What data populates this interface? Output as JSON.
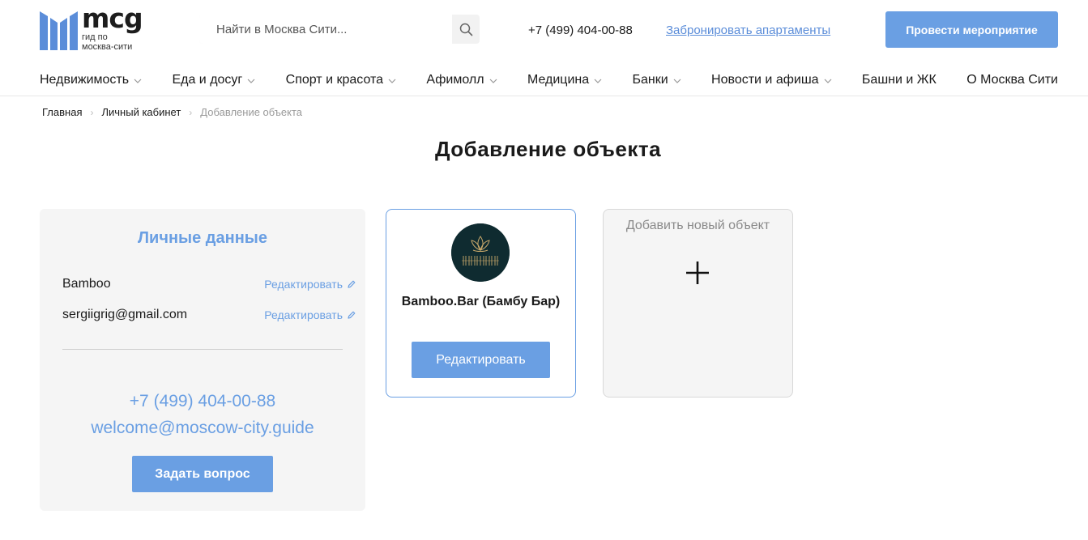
{
  "brand": {
    "name": "mcg",
    "tagline_line1": "гид по",
    "tagline_line2": "москва-сити",
    "color": "#5b8dd9"
  },
  "header": {
    "search_placeholder": "Найти в Москва Сити...",
    "phone": "+7 (499) 404-00-88",
    "book_link": "Забронировать апартаменты",
    "event_button": "Провести мероприятие"
  },
  "nav": {
    "items": [
      {
        "label": "Недвижимость",
        "has_dropdown": true
      },
      {
        "label": "Еда и досуг",
        "has_dropdown": true
      },
      {
        "label": "Спорт и красота",
        "has_dropdown": true
      },
      {
        "label": "Афимолл",
        "has_dropdown": true
      },
      {
        "label": "Медицина",
        "has_dropdown": true
      },
      {
        "label": "Банки",
        "has_dropdown": true
      },
      {
        "label": "Новости и афиша",
        "has_dropdown": true
      },
      {
        "label": "Башни и ЖК",
        "has_dropdown": false
      },
      {
        "label": "О Москва Сити",
        "has_dropdown": false
      }
    ]
  },
  "breadcrumb": {
    "items": [
      "Главная",
      "Личный кабинет",
      "Добавление объекта"
    ]
  },
  "page": {
    "title": "Добавление объекта"
  },
  "personal": {
    "title": "Личные данные",
    "name": "Bamboo",
    "email": "sergiigrig@gmail.com",
    "edit_label": "Редактировать",
    "contact_phone": "+7 (499) 404-00-88",
    "contact_email": "welcome@moscow-city.guide",
    "ask_button": "Задать вопрос"
  },
  "object": {
    "name": "Bamboo.Bar (Бамбу Бар)",
    "edit_button": "Редактировать"
  },
  "add_object": {
    "title": "Добавить новый объект",
    "icon": "plus-icon"
  },
  "colors": {
    "accent": "#6a9fe3",
    "text": "#1a1a1a",
    "muted": "#9a9a9a",
    "panel": "#f5f5f5"
  }
}
